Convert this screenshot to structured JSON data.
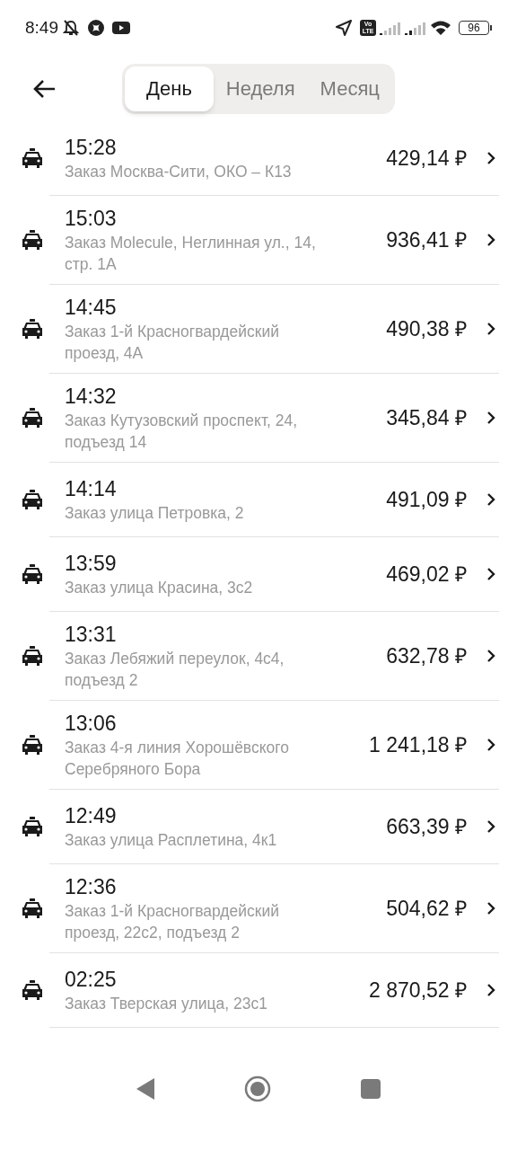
{
  "status_bar": {
    "time": "8:49",
    "network_badge": "Vo LTE",
    "battery": "96"
  },
  "tabs": [
    {
      "label": "День",
      "selected": true
    },
    {
      "label": "Неделя",
      "selected": false
    },
    {
      "label": "Месяц",
      "selected": false
    }
  ],
  "orders": [
    {
      "time": "15:28",
      "address": "Заказ Москва-Сити, ОКО – К13",
      "price": "429,14 ₽"
    },
    {
      "time": "15:03",
      "address": "Заказ Molecule, Неглинная ул., 14, стр. 1А",
      "price": "936,41 ₽"
    },
    {
      "time": "14:45",
      "address": "Заказ 1-й Красногвардейский проезд, 4А",
      "price": "490,38 ₽"
    },
    {
      "time": "14:32",
      "address": "Заказ Кутузовский проспект, 24, подъезд 14",
      "price": "345,84 ₽"
    },
    {
      "time": "14:14",
      "address": "Заказ улица Петровка, 2",
      "price": "491,09 ₽"
    },
    {
      "time": "13:59",
      "address": "Заказ улица Красина, 3с2",
      "price": "469,02 ₽"
    },
    {
      "time": "13:31",
      "address": "Заказ Лебяжий переулок, 4с4, подъезд 2",
      "price": "632,78 ₽"
    },
    {
      "time": "13:06",
      "address": "Заказ 4-я линия Хорошёвского Серебряного Бора",
      "price": "1 241,18 ₽"
    },
    {
      "time": "12:49",
      "address": "Заказ улица Расплетина, 4к1",
      "price": "663,39 ₽"
    },
    {
      "time": "12:36",
      "address": "Заказ 1-й Красногвардейский проезд, 22с2, подъезд 2",
      "price": "504,62 ₽"
    },
    {
      "time": "02:25",
      "address": "Заказ Тверская улица, 23с1",
      "price": "2 870,52 ₽"
    }
  ]
}
